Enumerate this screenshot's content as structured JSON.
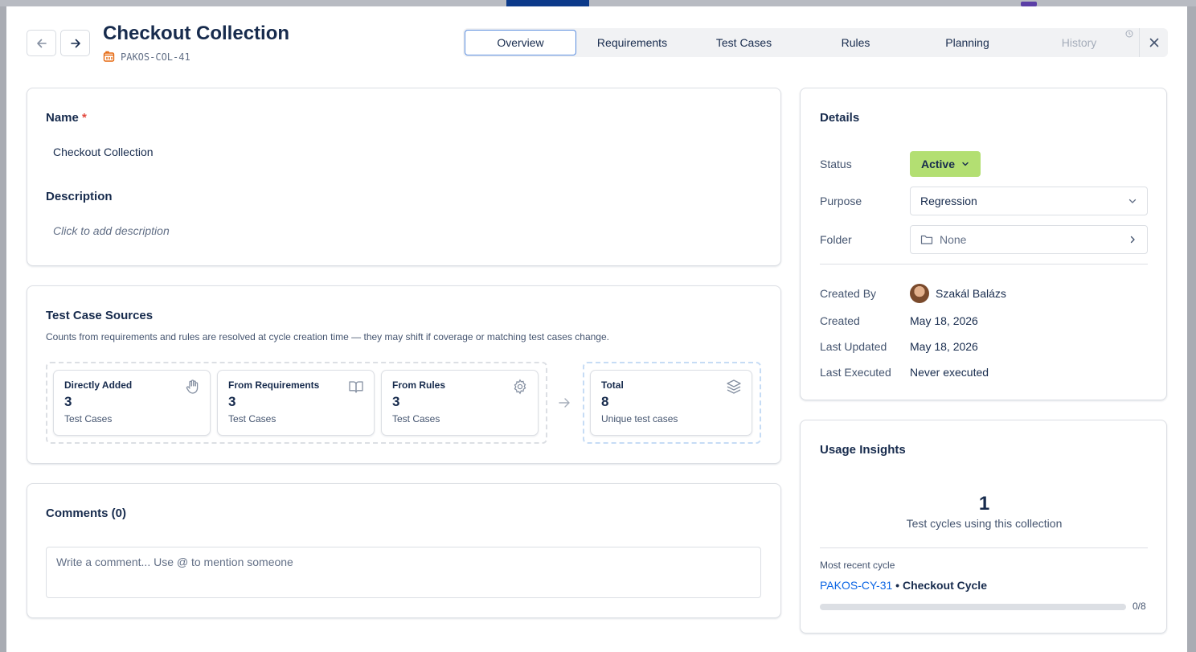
{
  "header": {
    "title": "Checkout Collection",
    "key": "PAKOS-COL-41"
  },
  "tabs": [
    {
      "label": "Overview",
      "state": "active"
    },
    {
      "label": "Requirements",
      "state": "normal"
    },
    {
      "label": "Test Cases",
      "state": "normal"
    },
    {
      "label": "Rules",
      "state": "normal"
    },
    {
      "label": "Planning",
      "state": "normal"
    },
    {
      "label": "History",
      "state": "disabled"
    }
  ],
  "main": {
    "name_label": "Name",
    "required_mark": "*",
    "name_value": "Checkout Collection",
    "description_label": "Description",
    "description_placeholder": "Click to add description"
  },
  "sources": {
    "title": "Test Case Sources",
    "helper": "Counts from requirements and rules are resolved at cycle creation time — they may shift if coverage or matching test cases change.",
    "items": [
      {
        "title": "Directly Added",
        "count": "3",
        "sub": "Test Cases",
        "icon": "hand-icon"
      },
      {
        "title": "From Requirements",
        "count": "3",
        "sub": "Test Cases",
        "icon": "book-icon"
      },
      {
        "title": "From Rules",
        "count": "3",
        "sub": "Test Cases",
        "icon": "gear-icon"
      }
    ],
    "total": {
      "title": "Total",
      "count": "8",
      "sub": "Unique test cases",
      "icon": "layers-icon"
    }
  },
  "comments": {
    "title": "Comments (0)",
    "placeholder": "Write a comment... Use @ to mention someone"
  },
  "details": {
    "title": "Details",
    "status_label": "Status",
    "status_value": "Active",
    "status_color": "#b3df72",
    "purpose_label": "Purpose",
    "purpose_value": "Regression",
    "folder_label": "Folder",
    "folder_value": "None",
    "created_by_label": "Created By",
    "created_by_value": "Szakál Balázs",
    "created_label": "Created",
    "created_value": "May 18, 2026",
    "updated_label": "Last Updated",
    "updated_value": "May 18, 2026",
    "executed_label": "Last Executed",
    "executed_value": "Never executed"
  },
  "usage": {
    "title": "Usage Insights",
    "count": "1",
    "count_sub": "Test cycles using this collection",
    "recent_label": "Most recent cycle",
    "cycle_key": "PAKOS-CY-31",
    "separator": " • ",
    "cycle_name": "Checkout Cycle",
    "progress_text": "0/8",
    "progress_fraction": 0
  },
  "colors": {
    "accent": "#0c66e4",
    "required": "#e2483d",
    "key_icon": "#e56910"
  }
}
